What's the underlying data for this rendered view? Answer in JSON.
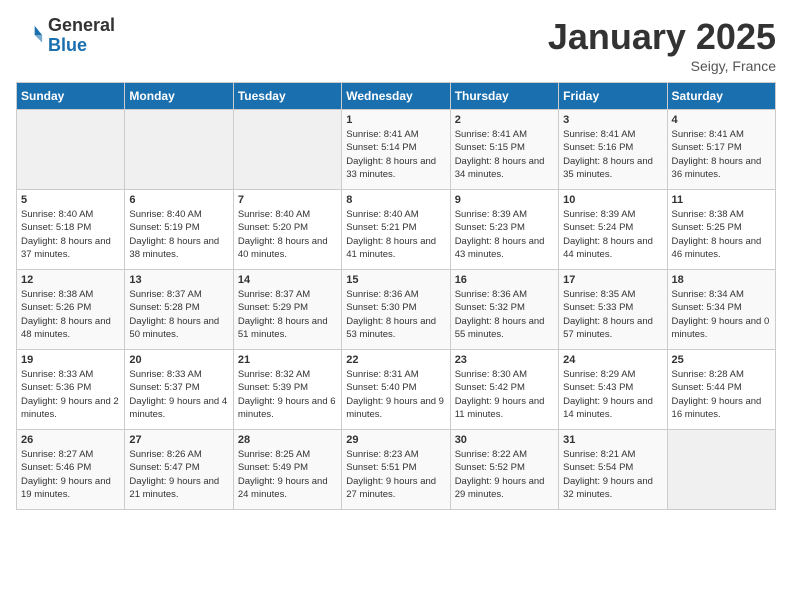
{
  "logo": {
    "general": "General",
    "blue": "Blue"
  },
  "title": "January 2025",
  "location": "Seigy, France",
  "days_of_week": [
    "Sunday",
    "Monday",
    "Tuesday",
    "Wednesday",
    "Thursday",
    "Friday",
    "Saturday"
  ],
  "weeks": [
    [
      {
        "day": "",
        "info": ""
      },
      {
        "day": "",
        "info": ""
      },
      {
        "day": "",
        "info": ""
      },
      {
        "day": "1",
        "info": "Sunrise: 8:41 AM\nSunset: 5:14 PM\nDaylight: 8 hours and 33 minutes."
      },
      {
        "day": "2",
        "info": "Sunrise: 8:41 AM\nSunset: 5:15 PM\nDaylight: 8 hours and 34 minutes."
      },
      {
        "day": "3",
        "info": "Sunrise: 8:41 AM\nSunset: 5:16 PM\nDaylight: 8 hours and 35 minutes."
      },
      {
        "day": "4",
        "info": "Sunrise: 8:41 AM\nSunset: 5:17 PM\nDaylight: 8 hours and 36 minutes."
      }
    ],
    [
      {
        "day": "5",
        "info": "Sunrise: 8:40 AM\nSunset: 5:18 PM\nDaylight: 8 hours and 37 minutes."
      },
      {
        "day": "6",
        "info": "Sunrise: 8:40 AM\nSunset: 5:19 PM\nDaylight: 8 hours and 38 minutes."
      },
      {
        "day": "7",
        "info": "Sunrise: 8:40 AM\nSunset: 5:20 PM\nDaylight: 8 hours and 40 minutes."
      },
      {
        "day": "8",
        "info": "Sunrise: 8:40 AM\nSunset: 5:21 PM\nDaylight: 8 hours and 41 minutes."
      },
      {
        "day": "9",
        "info": "Sunrise: 8:39 AM\nSunset: 5:23 PM\nDaylight: 8 hours and 43 minutes."
      },
      {
        "day": "10",
        "info": "Sunrise: 8:39 AM\nSunset: 5:24 PM\nDaylight: 8 hours and 44 minutes."
      },
      {
        "day": "11",
        "info": "Sunrise: 8:38 AM\nSunset: 5:25 PM\nDaylight: 8 hours and 46 minutes."
      }
    ],
    [
      {
        "day": "12",
        "info": "Sunrise: 8:38 AM\nSunset: 5:26 PM\nDaylight: 8 hours and 48 minutes."
      },
      {
        "day": "13",
        "info": "Sunrise: 8:37 AM\nSunset: 5:28 PM\nDaylight: 8 hours and 50 minutes."
      },
      {
        "day": "14",
        "info": "Sunrise: 8:37 AM\nSunset: 5:29 PM\nDaylight: 8 hours and 51 minutes."
      },
      {
        "day": "15",
        "info": "Sunrise: 8:36 AM\nSunset: 5:30 PM\nDaylight: 8 hours and 53 minutes."
      },
      {
        "day": "16",
        "info": "Sunrise: 8:36 AM\nSunset: 5:32 PM\nDaylight: 8 hours and 55 minutes."
      },
      {
        "day": "17",
        "info": "Sunrise: 8:35 AM\nSunset: 5:33 PM\nDaylight: 8 hours and 57 minutes."
      },
      {
        "day": "18",
        "info": "Sunrise: 8:34 AM\nSunset: 5:34 PM\nDaylight: 9 hours and 0 minutes."
      }
    ],
    [
      {
        "day": "19",
        "info": "Sunrise: 8:33 AM\nSunset: 5:36 PM\nDaylight: 9 hours and 2 minutes."
      },
      {
        "day": "20",
        "info": "Sunrise: 8:33 AM\nSunset: 5:37 PM\nDaylight: 9 hours and 4 minutes."
      },
      {
        "day": "21",
        "info": "Sunrise: 8:32 AM\nSunset: 5:39 PM\nDaylight: 9 hours and 6 minutes."
      },
      {
        "day": "22",
        "info": "Sunrise: 8:31 AM\nSunset: 5:40 PM\nDaylight: 9 hours and 9 minutes."
      },
      {
        "day": "23",
        "info": "Sunrise: 8:30 AM\nSunset: 5:42 PM\nDaylight: 9 hours and 11 minutes."
      },
      {
        "day": "24",
        "info": "Sunrise: 8:29 AM\nSunset: 5:43 PM\nDaylight: 9 hours and 14 minutes."
      },
      {
        "day": "25",
        "info": "Sunrise: 8:28 AM\nSunset: 5:44 PM\nDaylight: 9 hours and 16 minutes."
      }
    ],
    [
      {
        "day": "26",
        "info": "Sunrise: 8:27 AM\nSunset: 5:46 PM\nDaylight: 9 hours and 19 minutes."
      },
      {
        "day": "27",
        "info": "Sunrise: 8:26 AM\nSunset: 5:47 PM\nDaylight: 9 hours and 21 minutes."
      },
      {
        "day": "28",
        "info": "Sunrise: 8:25 AM\nSunset: 5:49 PM\nDaylight: 9 hours and 24 minutes."
      },
      {
        "day": "29",
        "info": "Sunrise: 8:23 AM\nSunset: 5:51 PM\nDaylight: 9 hours and 27 minutes."
      },
      {
        "day": "30",
        "info": "Sunrise: 8:22 AM\nSunset: 5:52 PM\nDaylight: 9 hours and 29 minutes."
      },
      {
        "day": "31",
        "info": "Sunrise: 8:21 AM\nSunset: 5:54 PM\nDaylight: 9 hours and 32 minutes."
      },
      {
        "day": "",
        "info": ""
      }
    ]
  ]
}
